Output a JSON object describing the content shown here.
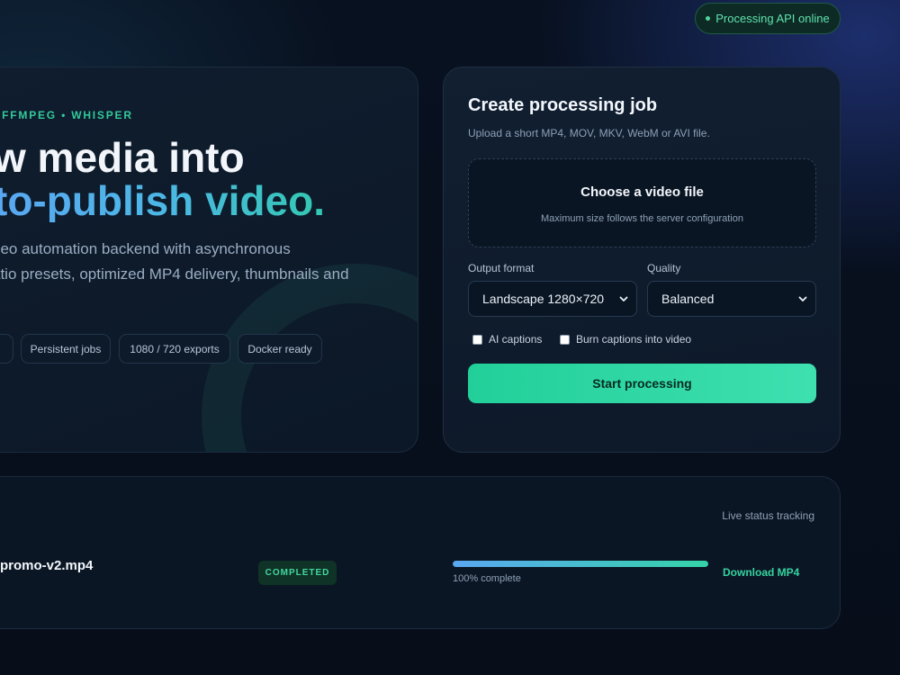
{
  "header": {
    "status": "Processing API online"
  },
  "hero": {
    "eyebrow": "• FFMPEG • WHISPER",
    "headline_line1": "w media into",
    "headline_line2": "to-publish video.",
    "description_line1": "deo automation backend with asynchronous",
    "description_line2": "atio presets, optimized MP4 delivery, thumbnails and",
    "chips": [
      "l",
      "Persistent jobs",
      "1080 / 720 exports",
      "Docker ready"
    ]
  },
  "job_form": {
    "title": "Create processing job",
    "subtitle": "Upload a short MP4, MOV, MKV, WebM or AVI file.",
    "dropzone_title": "Choose a video file",
    "dropzone_subtitle": "Maximum size follows the server configuration",
    "output_format_label": "Output format",
    "output_format_value": "Landscape 1280×720",
    "quality_label": "Quality",
    "quality_value": "Balanced",
    "ai_captions_label": "AI captions",
    "ai_captions_checked": false,
    "burn_captions_label": "Burn captions into video",
    "burn_captions_checked": false,
    "start_button": "Start processing"
  },
  "jobs": {
    "live_status": "Live status tracking",
    "items": [
      {
        "file_name": "-promo-v2.mp4",
        "status": "COMPLETED",
        "progress": 100,
        "progress_text": "100% complete",
        "download_label": "Download MP4"
      }
    ]
  },
  "colors": {
    "accent_green": "#22cf99",
    "accent_blue": "#5aa7f2",
    "background": "#07101d"
  }
}
